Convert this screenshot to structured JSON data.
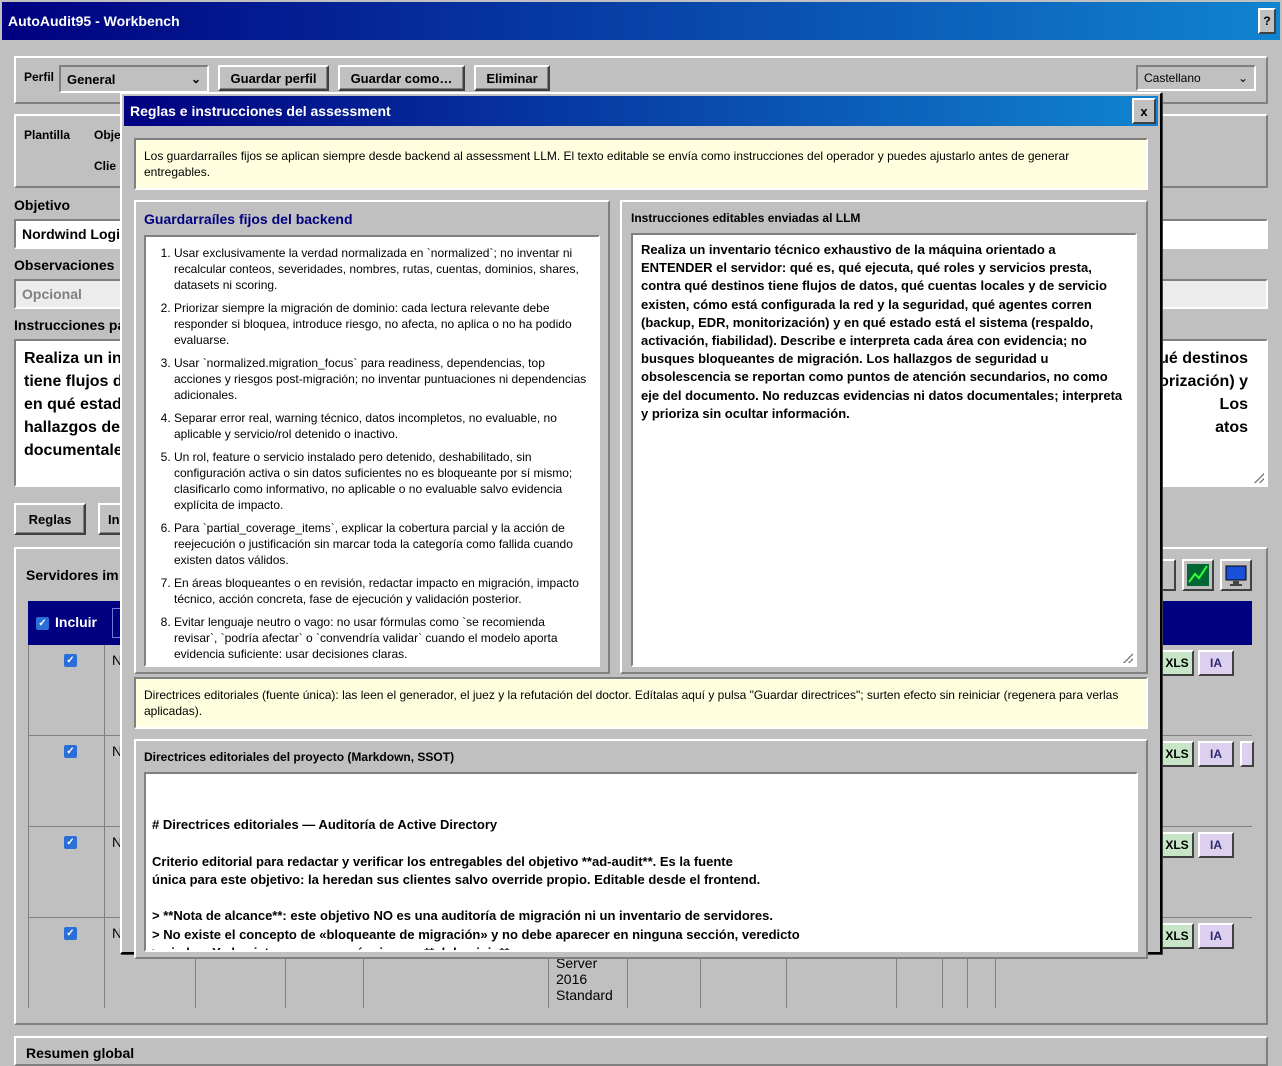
{
  "window": {
    "title": "AutoAudit95 - Workbench",
    "help_label": "?"
  },
  "profile": {
    "label": "Perfil",
    "selected": "General",
    "save_label": "Guardar perfil",
    "save_as_label": "Guardar como…",
    "delete_label": "Eliminar",
    "language": "Castellano"
  },
  "template": {
    "label": "Plantilla",
    "objective_partial": "Obje",
    "client_partial": "Clie"
  },
  "objective": {
    "label": "Objetivo",
    "value": "Nordwind Logi"
  },
  "observations": {
    "label": "Observaciones",
    "placeholder": "Opcional"
  },
  "instructions_bg": {
    "label": "Instrucciones pa",
    "left_lines": [
      "Realiza un in",
      "tiene flujos d",
      "en qué estad",
      "hallazgos de",
      "documentale"
    ],
    "right_lines": [
      "ué destinos",
      "orización) y",
      "Los",
      "atos"
    ]
  },
  "bg_tabs": {
    "rules": "Reglas",
    "second_partial": "In"
  },
  "servers": {
    "title": "Servidores im",
    "include_label": "Incluir",
    "rows": [
      {
        "first": "N",
        "xls": "XLS",
        "ia": "IA"
      },
      {
        "first": "N",
        "xls": "XLS",
        "ia": "IA"
      },
      {
        "first": "N",
        "xls": "XLS",
        "ia": "IA"
      },
      {
        "first": "N",
        "xls": "XLS",
        "ia": "IA",
        "os_lines": [
          "Server",
          "2016",
          "Standard"
        ]
      }
    ]
  },
  "summary": {
    "title": "Resumen global"
  },
  "modal": {
    "title": "Reglas e instrucciones del assessment",
    "close_label": "x",
    "intro_note": "Los guardarraíles fijos se aplican siempre desde backend al assessment LLM. El texto editable se envía como instrucciones del operador y puedes ajustarlo antes de generar entregables.",
    "guardrails_title": "Guardarraíles fijos del backend",
    "guardrails": [
      "Usar exclusivamente la verdad normalizada en `normalized`; no inventar ni recalcular conteos, severidades, nombres, rutas, cuentas, dominios, shares, datasets ni scoring.",
      "Priorizar siempre la migración de dominio: cada lectura relevante debe responder si bloquea, introduce riesgo, no afecta, no aplica o no ha podido evaluarse.",
      "Usar `normalized.migration_focus` para readiness, dependencias, top acciones y riesgos post-migración; no inventar puntuaciones ni dependencias adicionales.",
      "Separar error real, warning técnico, datos incompletos, no evaluable, no aplicable y servicio/rol detenido o inactivo.",
      "Un rol, feature o servicio instalado pero detenido, deshabilitado, sin configuración activa o sin datos suficientes no es bloqueante por sí mismo; clasificarlo como informativo, no aplicable o no evaluable salvo evidencia explícita de impacto.",
      "Para `partial_coverage_items`, explicar la cobertura parcial y la acción de reejecución o justificación sin marcar toda la categoría como fallida cuando existen datos válidos.",
      "En áreas bloqueantes o en revisión, redactar impacto en migración, impacto técnico, acción concreta, fase de ejecución y validación posterior.",
      "Evitar lenguaje neutro o vago: no usar fórmulas como `se recomienda revisar`, `podría afectar` o `convendría validar` cuando el modelo aporta evidencia suficiente: usar decisiones claras."
    ],
    "editable_title": "Instrucciones editables enviadas al LLM",
    "editable_text": "Realiza un inventario técnico exhaustivo de la máquina orientado a ENTENDER el servidor: qué es, qué ejecuta, qué roles y servicios presta, contra qué destinos tiene flujos de datos, qué cuentas locales y de servicio existen, cómo está configurada la red y la seguridad, qué agentes corren (backup, EDR, monitorización) y en qué estado está el sistema (respaldo, activación, fiabilidad). Describe e interpreta cada área con evidencia; no busques bloqueantes de migración. Los hallazgos de seguridad u obsolescencia se reportan como puntos de atención secundarios, no como eje del documento. No reduzcas evidencias ni datos documentales; interpreta y prioriza sin ocultar información.",
    "editorial_note": "Directrices editoriales (fuente única): las leen el generador, el juez y la refutación del doctor. Edítalas aquí y pulsa \"Guardar directrices\"; surten efecto sin reiniciar (regenera para verlas aplicadas).",
    "editorial_title": "Directrices editoriales del proyecto (Markdown, SSOT)",
    "editorial_text": "# Directrices editoriales — Auditoría de Active Directory\n\nCriterio editorial para redactar y verificar los entregables del objetivo **ad-audit**. Es la fuente\núnica para este objetivo: la heredan sus clientes salvo override propio. Editable desde el frontend.\n\n> **Nota de alcance**: este objetivo NO es una auditoría de migración ni un inventario de servidores.\n> No existe el concepto de «bloqueante de migración» y no debe aparecer en ninguna sección, veredicto\n> ni plan. Y el sujeto no es una máquina: es **el dominio**.\n\n## Propósito del documento"
  }
}
